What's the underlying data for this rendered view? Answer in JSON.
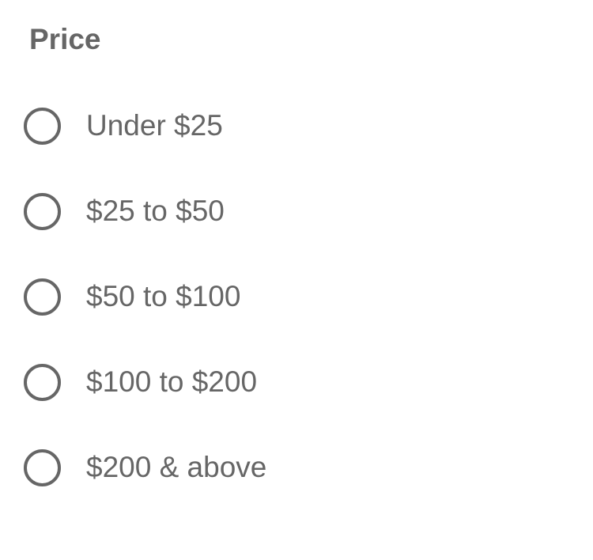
{
  "price_filter": {
    "title": "Price",
    "options": [
      {
        "label": "Under $25",
        "checked": false
      },
      {
        "label": "$25 to $50",
        "checked": false
      },
      {
        "label": "$50 to $100",
        "checked": false
      },
      {
        "label": "$100 to $200",
        "checked": false
      },
      {
        "label": "$200 & above",
        "checked": false
      }
    ]
  },
  "colors": {
    "text": "#666666",
    "radio_border": "#666666",
    "background": "#ffffff"
  }
}
